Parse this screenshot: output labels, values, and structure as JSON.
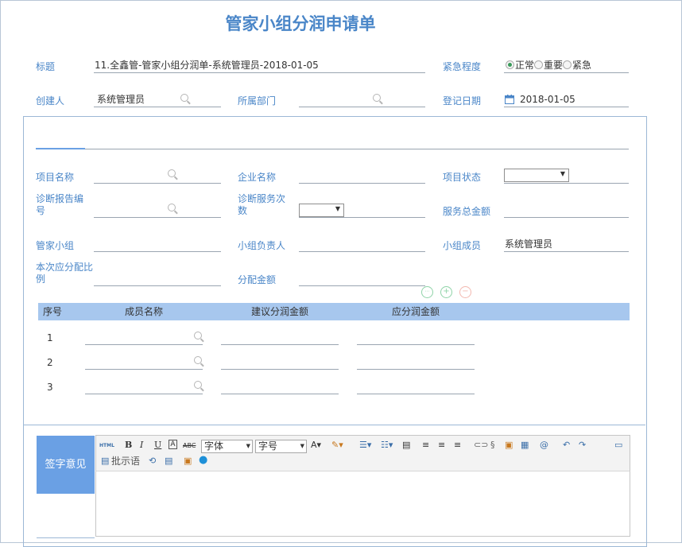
{
  "page_title": "管家小组分润申请单",
  "header": {
    "title_label": "标题",
    "title_value": "11.全鑫管-管家小组分润单-系统管理员-2018-01-05",
    "urgency_label": "紧急程度",
    "urgency_options": [
      "正常",
      "重要",
      "紧急"
    ],
    "urgency_selected": "正常",
    "creator_label": "创建人",
    "creator_value": "系统管理员",
    "dept_label": "所属部门",
    "dept_value": "",
    "date_label": "登记日期",
    "date_value": "2018-01-05"
  },
  "form": {
    "project_name_label": "项目名称",
    "company_name_label": "企业名称",
    "project_status_label": "项目状态",
    "report_no_label_1": "诊断报告编",
    "report_no_label_2": "号",
    "service_count_label_1": "诊断服务次",
    "service_count_label_2": "数",
    "service_total_label": "服务总金额",
    "steward_group_label": "管家小组",
    "group_leader_label": "小组负责人",
    "group_members_label": "小组成员",
    "group_members_value": "系统管理员",
    "ratio_label_1": "本次应分配比",
    "ratio_label_2": "例",
    "allot_amount_label": "分配金额"
  },
  "table": {
    "headers": [
      "序号",
      "成员名称",
      "建议分润金额",
      "应分润金额"
    ],
    "rows": [
      "1",
      "2",
      "3"
    ]
  },
  "signature": {
    "label": "签字意见",
    "font_label": "字体",
    "size_label": "字号",
    "annotation_label": "批示语"
  }
}
